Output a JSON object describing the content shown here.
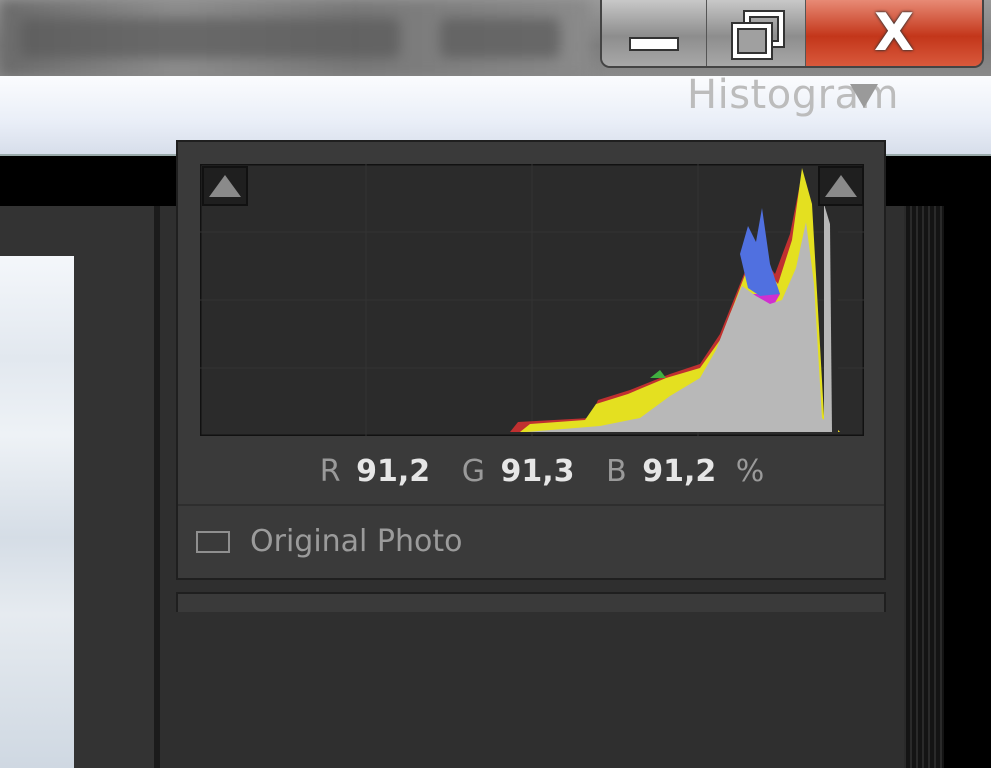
{
  "window": {
    "controls": {
      "minimize_icon": "minimize-icon",
      "maximize_icon": "restore-icon",
      "close_glyph": "X"
    }
  },
  "panel": {
    "title": "Histogram",
    "toggle_icon": "triangle-down-icon",
    "readout": {
      "r_label": "R",
      "r_value": "91,2",
      "g_label": "G",
      "g_value": "91,3",
      "b_label": "B",
      "b_value": "91,2",
      "unit": "%"
    },
    "original_photo_label": "Original Photo",
    "original_photo_checked": false
  },
  "colors": {
    "panel_bg": "#2f2f2f",
    "graph_bg": "#2b2b2b",
    "close_red": "#c3361a"
  }
}
